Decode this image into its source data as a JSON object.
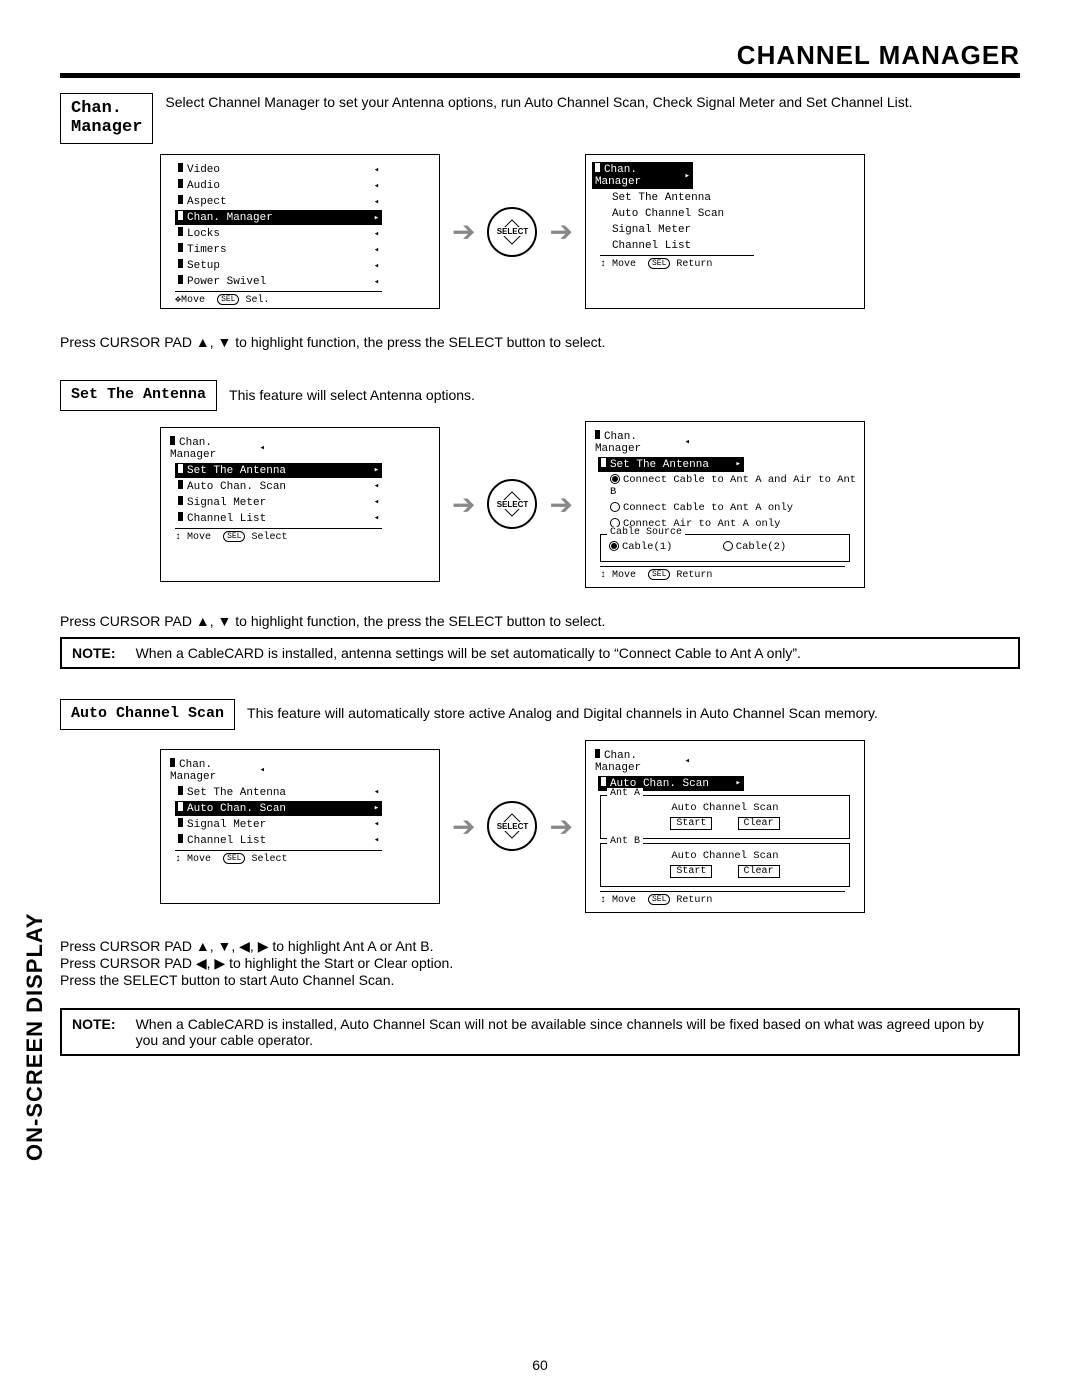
{
  "page_title": "CHANNEL MANAGER",
  "sidebar_tab": "ON-SCREEN DISPLAY",
  "page_number": "60",
  "chan_manager_box": "Chan.\nManager",
  "chan_manager_desc": "Select Channel Manager to set your Antenna options, run Auto Channel Scan, Check Signal Meter and Set Channel List.",
  "instr_cursor_select": "Press CURSOR PAD ▲, ▼ to highlight function, the press the SELECT button to select.",
  "osd_main_items": [
    "Video",
    "Audio",
    "Aspect",
    "Chan. Manager",
    "Locks",
    "Timers",
    "Setup",
    "Power Swivel"
  ],
  "osd_main_footer_move": "Move",
  "osd_main_footer_sel_badge": "SEL",
  "osd_main_footer_sel": "Sel.",
  "osd_cm_title": "Chan. Manager",
  "osd_cm_items": [
    "Set The Antenna",
    "Auto Channel Scan",
    "Signal Meter",
    "Channel List"
  ],
  "osd_cm_footer_move": "Move",
  "osd_cm_footer_return": "Return",
  "select_btn_label": "SELECT",
  "set_antenna_box": "Set The Antenna",
  "set_antenna_desc": "This feature will select Antenna options.",
  "osd_cm2_items": [
    "Set The Antenna",
    "Auto Chan. Scan",
    "Signal Meter",
    "Channel List"
  ],
  "osd_cm2_footer_select": "Select",
  "set_antenna_options": [
    "Connect Cable to Ant A and Air to Ant B",
    "Connect Cable to Ant A only",
    "Connect Air to Ant A only"
  ],
  "cable_source_legend": "Cable Source",
  "cable_source_cable1": "Cable(1)",
  "cable_source_cable2": "Cable(2)",
  "note1_label": "NOTE:",
  "note1_text": "When a CableCARD is installed, antenna settings will be set automatically to “Connect Cable to Ant A only”.",
  "auto_scan_box": "Auto Channel Scan",
  "auto_scan_desc": "This feature will automatically store active Analog and Digital channels in Auto Channel Scan memory.",
  "osd_cm3_items": [
    "Set The Antenna",
    "Auto Chan. Scan",
    "Signal Meter",
    "Channel List"
  ],
  "auto_scan_legend_a": "Ant A",
  "auto_scan_legend_b": "Ant B",
  "auto_scan_label": "Auto Channel Scan",
  "auto_scan_start": "Start",
  "auto_scan_clear": "Clear",
  "auto_instr_line1": "Press CURSOR PAD ▲, ▼, ◀, ▶ to highlight Ant A or Ant B.",
  "auto_instr_line2": "Press CURSOR PAD ◀, ▶ to highlight the Start or Clear option.",
  "auto_instr_line3": "Press the SELECT button to start Auto Channel Scan.",
  "note2_label": "NOTE:",
  "note2_text": "When a CableCARD is installed, Auto Channel Scan will not be available since channels will be fixed based on what was agreed upon by you and your cable operator.",
  "move_arrows": "↕",
  "move_cross": "✥",
  "arrow_ind_right": "▸",
  "arrow_ind_left": "◂"
}
